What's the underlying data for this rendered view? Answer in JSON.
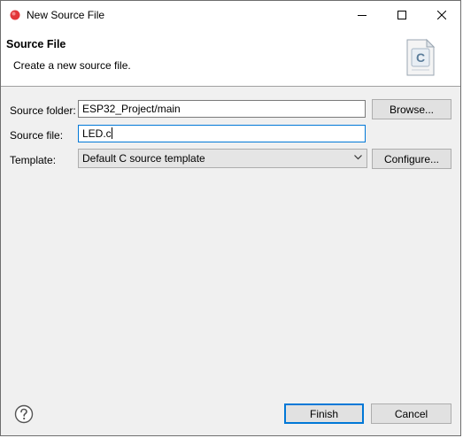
{
  "window": {
    "title": "New Source File",
    "controls": [
      "minimize-icon",
      "maximize-icon",
      "close-icon"
    ]
  },
  "banner": {
    "title": "Source File",
    "description": "Create a new source file.",
    "graphic_letter": "C"
  },
  "form": {
    "source_folder_label": "Source folder:",
    "source_folder_value": "ESP32_Project/main",
    "browse_label": "Browse...",
    "source_file_label": "Source file:",
    "source_file_value": "LED.c",
    "template_label": "Template:",
    "template_value": "Default C source template",
    "configure_label": "Configure..."
  },
  "footer": {
    "help_icon": "help-icon",
    "finish_label": "Finish",
    "cancel_label": "Cancel"
  },
  "colors": {
    "accent": "#0078d7",
    "app_icon": "#e2383a"
  }
}
